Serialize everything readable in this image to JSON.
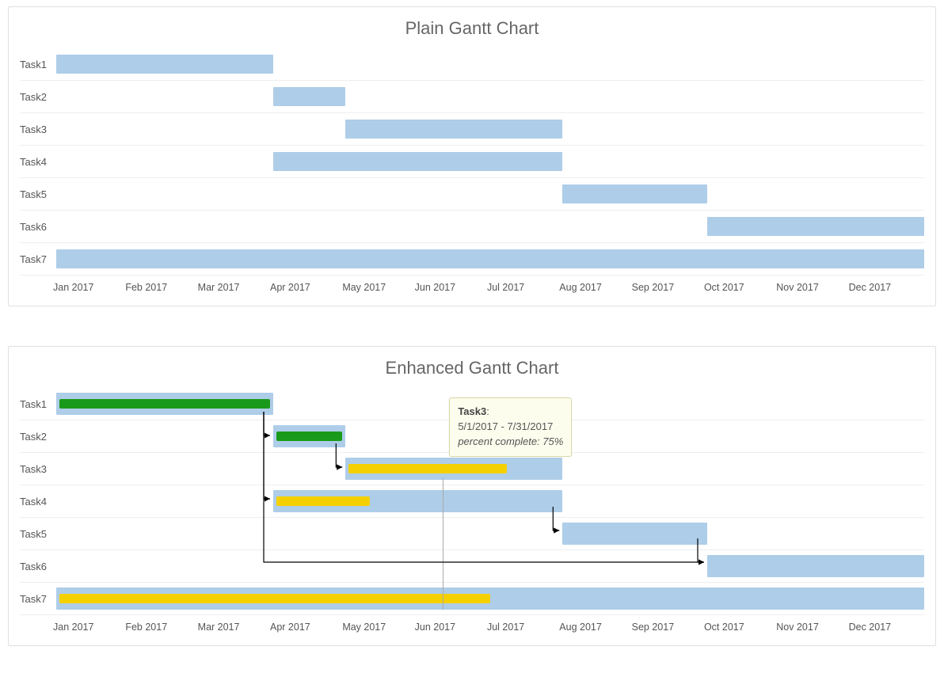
{
  "timeline": {
    "start": "2017-01-01",
    "end": "2018-01-01",
    "unit": "month",
    "months": [
      "Jan 2017",
      "Feb 2017",
      "Mar 2017",
      "Apr 2017",
      "May 2017",
      "Jun 2017",
      "Jul 2017",
      "Aug 2017",
      "Sep 2017",
      "Oct 2017",
      "Nov 2017",
      "Dec 2017"
    ]
  },
  "plain": {
    "title": "Plain Gantt Chart",
    "tasks": [
      {
        "name": "Task1",
        "start": 0,
        "end": 3
      },
      {
        "name": "Task2",
        "start": 3,
        "end": 4
      },
      {
        "name": "Task3",
        "start": 4,
        "end": 7
      },
      {
        "name": "Task4",
        "start": 3,
        "end": 7
      },
      {
        "name": "Task5",
        "start": 7,
        "end": 9
      },
      {
        "name": "Task6",
        "start": 9,
        "end": 12
      },
      {
        "name": "Task7",
        "start": 0,
        "end": 12
      }
    ]
  },
  "enhanced": {
    "title": "Enhanced Gantt Chart",
    "tasks": [
      {
        "name": "Task1",
        "start": 0,
        "end": 3,
        "pct": 100,
        "pctColor": "green"
      },
      {
        "name": "Task2",
        "start": 3,
        "end": 4,
        "pct": 100,
        "pctColor": "green"
      },
      {
        "name": "Task3",
        "start": 4,
        "end": 7,
        "pct": 75,
        "pctColor": "yellow"
      },
      {
        "name": "Task4",
        "start": 3,
        "end": 7,
        "pct": 33,
        "pctColor": "yellow"
      },
      {
        "name": "Task5",
        "start": 7,
        "end": 9,
        "pct": 0,
        "pctColor": "yellow"
      },
      {
        "name": "Task6",
        "start": 9,
        "end": 12,
        "pct": 0,
        "pctColor": "yellow"
      },
      {
        "name": "Task7",
        "start": 0,
        "end": 12,
        "pct": 50,
        "pctColor": "yellow"
      }
    ],
    "dependencies": [
      {
        "from": "Task1",
        "to": "Task2"
      },
      {
        "from": "Task2",
        "to": "Task3"
      },
      {
        "from": "Task1",
        "to": "Task4"
      },
      {
        "from": "Task4",
        "to": "Task5"
      },
      {
        "from": "Task5",
        "to": "Task6"
      },
      {
        "from": "Task1",
        "to": "Task6"
      }
    ],
    "tooltip": {
      "taskIndex": 2,
      "label": "Task3",
      "rangeText": "5/1/2017 - 7/31/2017",
      "pctLabel": "percent complete: 75%"
    }
  },
  "colors": {
    "bar": "#aecde8",
    "pctGreen": "#1a9a1a",
    "pctYellow": "#f5d000",
    "tooltipBg": "#fdfdee",
    "tooltipBorder": "#d8d8a8"
  },
  "chart_data": [
    {
      "type": "gantt",
      "title": "Plain Gantt Chart",
      "x_unit": "month",
      "x_range": [
        "2017-01",
        "2017-12"
      ],
      "x_ticks": [
        "Jan 2017",
        "Feb 2017",
        "Mar 2017",
        "Apr 2017",
        "May 2017",
        "Jun 2017",
        "Jul 2017",
        "Aug 2017",
        "Sep 2017",
        "Oct 2017",
        "Nov 2017",
        "Dec 2017"
      ],
      "tasks": [
        {
          "name": "Task1",
          "start": "2017-01-01",
          "end": "2017-04-01"
        },
        {
          "name": "Task2",
          "start": "2017-04-01",
          "end": "2017-05-01"
        },
        {
          "name": "Task3",
          "start": "2017-05-01",
          "end": "2017-08-01"
        },
        {
          "name": "Task4",
          "start": "2017-04-01",
          "end": "2017-08-01"
        },
        {
          "name": "Task5",
          "start": "2017-08-01",
          "end": "2017-10-01"
        },
        {
          "name": "Task6",
          "start": "2017-10-01",
          "end": "2018-01-01"
        },
        {
          "name": "Task7",
          "start": "2017-01-01",
          "end": "2018-01-01"
        }
      ]
    },
    {
      "type": "gantt",
      "title": "Enhanced Gantt Chart",
      "x_unit": "month",
      "x_range": [
        "2017-01",
        "2017-12"
      ],
      "x_ticks": [
        "Jan 2017",
        "Feb 2017",
        "Mar 2017",
        "Apr 2017",
        "May 2017",
        "Jun 2017",
        "Jul 2017",
        "Aug 2017",
        "Sep 2017",
        "Oct 2017",
        "Nov 2017",
        "Dec 2017"
      ],
      "tasks": [
        {
          "name": "Task1",
          "start": "2017-01-01",
          "end": "2017-04-01",
          "percent_complete": 100
        },
        {
          "name": "Task2",
          "start": "2017-04-01",
          "end": "2017-05-01",
          "percent_complete": 100
        },
        {
          "name": "Task3",
          "start": "2017-05-01",
          "end": "2017-08-01",
          "percent_complete": 75
        },
        {
          "name": "Task4",
          "start": "2017-04-01",
          "end": "2017-08-01",
          "percent_complete": 33
        },
        {
          "name": "Task5",
          "start": "2017-08-01",
          "end": "2017-10-01",
          "percent_complete": 0
        },
        {
          "name": "Task6",
          "start": "2017-10-01",
          "end": "2018-01-01",
          "percent_complete": 0
        },
        {
          "name": "Task7",
          "start": "2017-01-01",
          "end": "2018-01-01",
          "percent_complete": 50
        }
      ],
      "dependencies": [
        {
          "from": "Task1",
          "to": "Task2"
        },
        {
          "from": "Task2",
          "to": "Task3"
        },
        {
          "from": "Task1",
          "to": "Task4"
        },
        {
          "from": "Task4",
          "to": "Task5"
        },
        {
          "from": "Task5",
          "to": "Task6"
        },
        {
          "from": "Task1",
          "to": "Task6"
        }
      ],
      "tooltip_shown": {
        "task": "Task3",
        "range": "5/1/2017 - 7/31/2017",
        "percent_complete": 75
      }
    }
  ]
}
